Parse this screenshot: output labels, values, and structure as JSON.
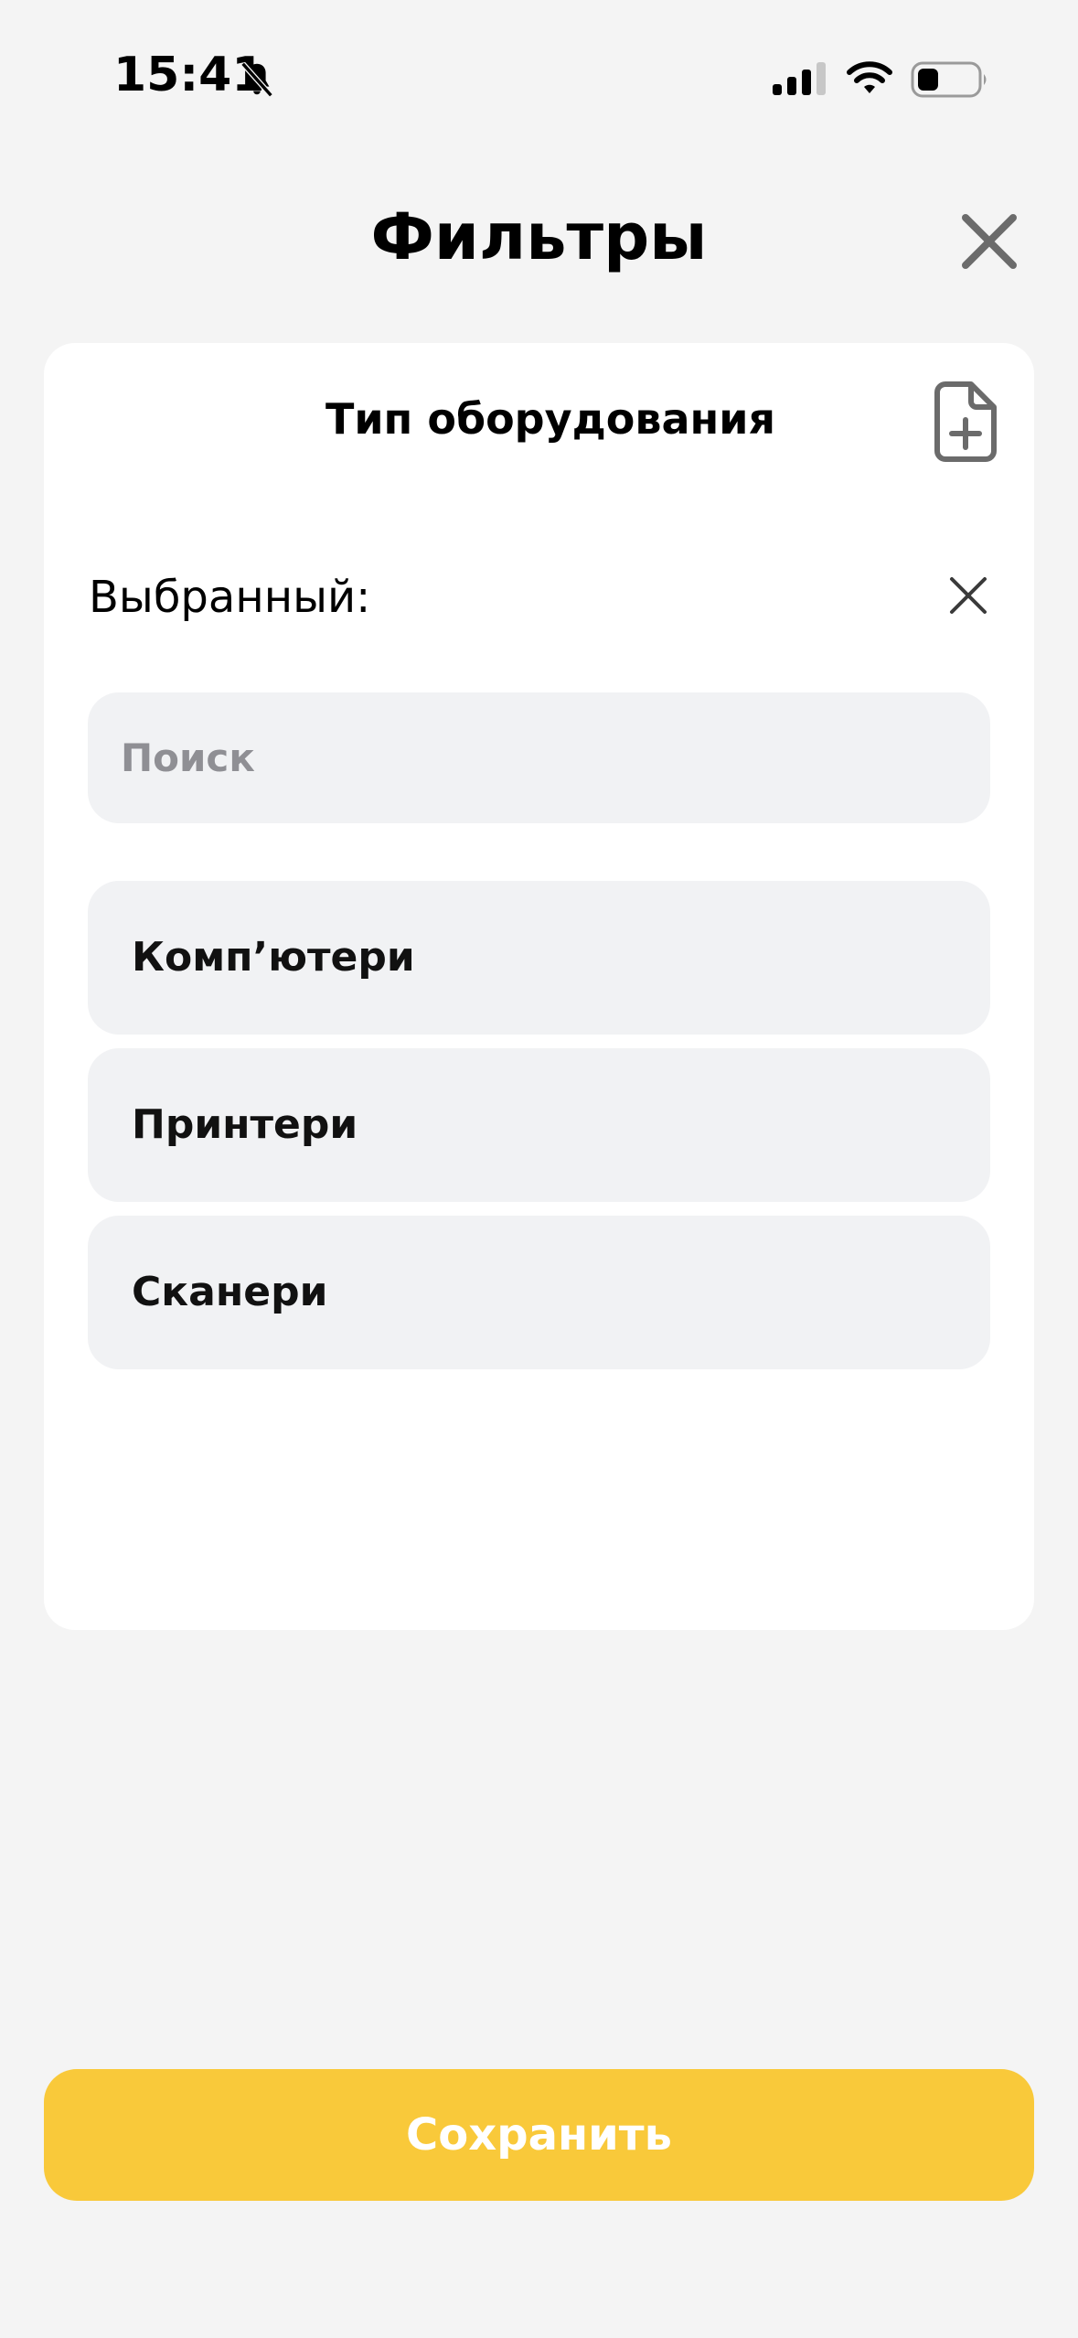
{
  "status_bar": {
    "time": "15:41",
    "icons": [
      "bell-slash-icon",
      "cellular-signal-icon",
      "wifi-icon",
      "battery-icon"
    ]
  },
  "header": {
    "title": "Фильтры",
    "close_icon": "close-icon"
  },
  "card": {
    "title": "Тип оборудования",
    "action_icon": "add-file-icon",
    "selected_label": "Выбранный:",
    "clear_icon": "close-icon",
    "search": {
      "placeholder": "Поиск",
      "value": ""
    },
    "options": [
      {
        "label": "Комп’ютери"
      },
      {
        "label": "Принтери"
      },
      {
        "label": "Сканери"
      }
    ]
  },
  "footer": {
    "save_label": "Сохранить"
  },
  "colors": {
    "background": "#f4f4f4",
    "card": "#ffffff",
    "option_bg": "#f1f2f4",
    "accent": "#f9c93a",
    "icon_gray": "#6b6b6b"
  }
}
